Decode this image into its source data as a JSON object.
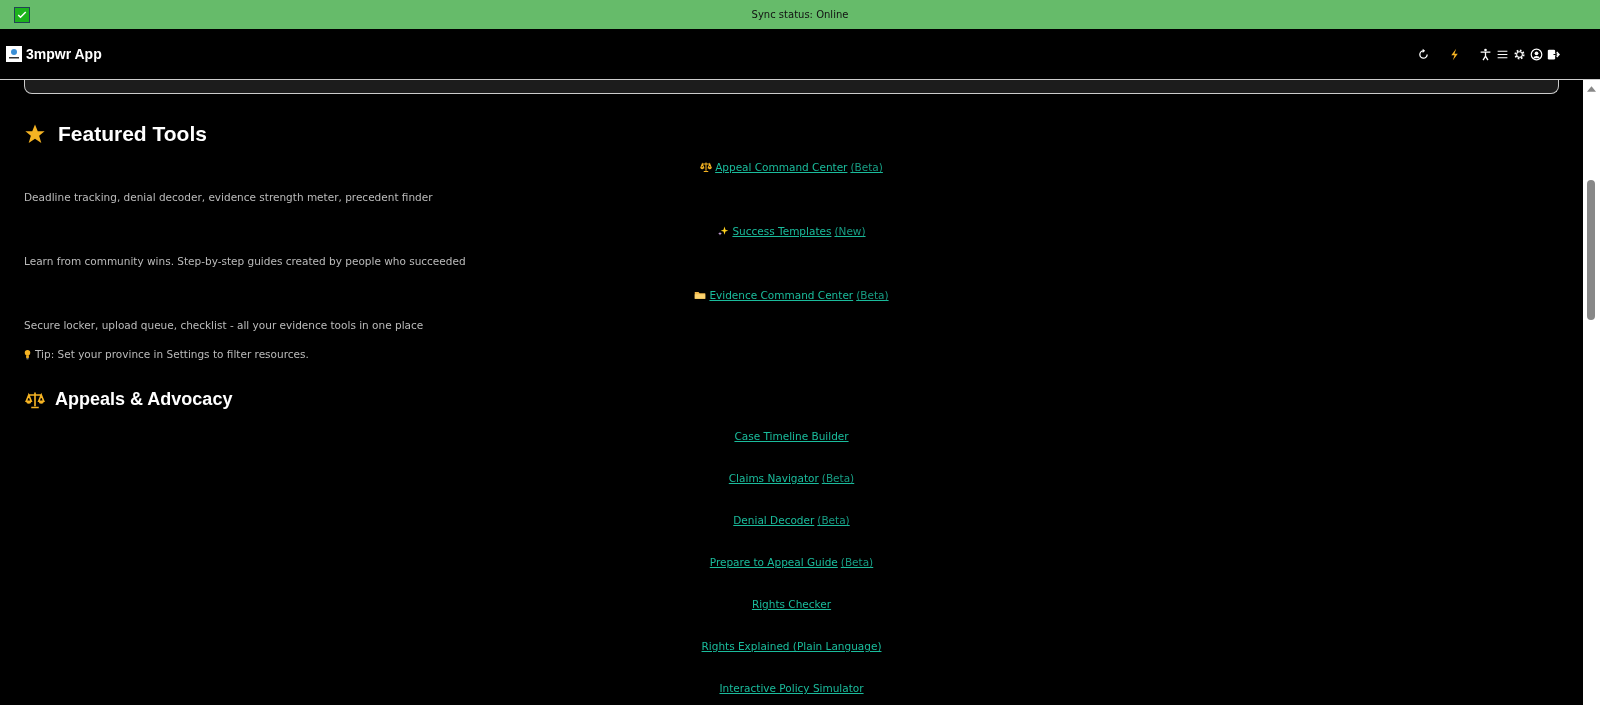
{
  "status_bar": {
    "text": "Sync status: Online",
    "online": true
  },
  "header": {
    "title": "3mpwr App"
  },
  "featured": {
    "title": "Featured Tools",
    "items": [
      {
        "kind": "scales",
        "label": "Appeal Command Center",
        "badge": "(Beta)",
        "description": "Deadline tracking, denial decoder, evidence strength meter, precedent finder"
      },
      {
        "kind": "sparkles",
        "label": "Success Templates",
        "badge": "(New)",
        "description": "Learn from community wins. Step-by-step guides created by people who succeeded"
      },
      {
        "kind": "folder",
        "label": "Evidence Command Center",
        "badge": "(Beta)",
        "description": "Secure locker, upload queue, checklist - all your evidence tools in one place"
      }
    ],
    "tip": "Tip: Set your province in Settings to filter resources."
  },
  "appeals": {
    "title": "Appeals & Advocacy",
    "links": [
      {
        "label": "Case Timeline Builder"
      },
      {
        "label": "Claims Navigator",
        "badge": "(Beta)"
      },
      {
        "label": "Denial Decoder",
        "badge": "(Beta)"
      },
      {
        "label": "Prepare to Appeal Guide",
        "badge": "(Beta)"
      },
      {
        "label": "Rights Checker"
      },
      {
        "label": "Rights Explained (Plain Language)"
      },
      {
        "label": "Interactive Policy Simulator"
      }
    ]
  }
}
